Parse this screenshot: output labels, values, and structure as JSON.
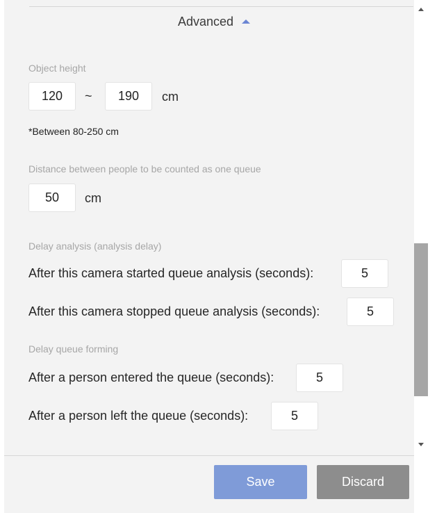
{
  "advanced": {
    "label": "Advanced"
  },
  "object_height": {
    "title": "Object height",
    "min_value": "120",
    "separator": "~",
    "max_value": "190",
    "unit": "cm",
    "note": "*Between 80-250 cm"
  },
  "distance": {
    "title": "Distance between people to be counted as one queue",
    "value": "50",
    "unit": "cm"
  },
  "delay_analysis": {
    "title": "Delay analysis (analysis delay)",
    "started_label": "After this camera started queue analysis (seconds):",
    "started_value": "5",
    "stopped_label": "After this camera stopped queue analysis (seconds):",
    "stopped_value": "5"
  },
  "delay_queue": {
    "title": "Delay queue forming",
    "entered_label": "After a person entered the queue (seconds):",
    "entered_value": "5",
    "left_label": "After a person left the queue (seconds):",
    "left_value": "5"
  },
  "buttons": {
    "save": "Save",
    "discard": "Discard"
  },
  "colors": {
    "accent": "#7f9bd8",
    "discard": "#8d8d8d",
    "panel_bg": "#f3f3f3"
  }
}
